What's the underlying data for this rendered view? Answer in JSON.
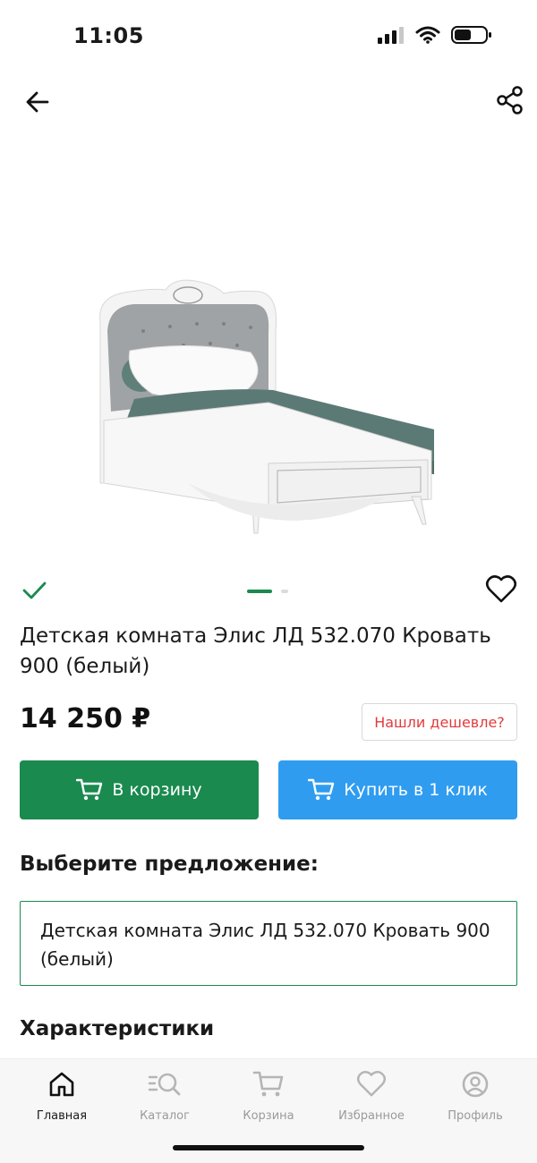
{
  "status": {
    "time": "11:05"
  },
  "product": {
    "title": "Детская комната Элис ЛД 532.070 Кровать 900 (белый)",
    "price": "14 250 ₽",
    "image_icon": "bed-image"
  },
  "gallery": {
    "total_images": 2,
    "current": 1
  },
  "actions": {
    "cheaper_label": "Нашли дешевле?",
    "cart_label": "В корзину",
    "oneclick_label": "Купить в 1 клик"
  },
  "offers": {
    "heading": "Выберите предложение:",
    "selected": "Детская комната Элис ЛД 532.070 Кровать 900 (белый)"
  },
  "specs": {
    "heading": "Характеристики"
  },
  "tabbar": {
    "items": [
      {
        "label": "Главная",
        "icon": "home-icon",
        "active": true
      },
      {
        "label": "Каталог",
        "icon": "catalog-search-icon",
        "active": false
      },
      {
        "label": "Корзина",
        "icon": "cart-icon",
        "active": false
      },
      {
        "label": "Избранное",
        "icon": "heart-icon",
        "active": false
      },
      {
        "label": "Профиль",
        "icon": "profile-icon",
        "active": false
      }
    ]
  },
  "colors": {
    "primary_green": "#1a8a4f",
    "accent_blue": "#2f9cf0",
    "cheaper_red": "#e23b3b"
  }
}
